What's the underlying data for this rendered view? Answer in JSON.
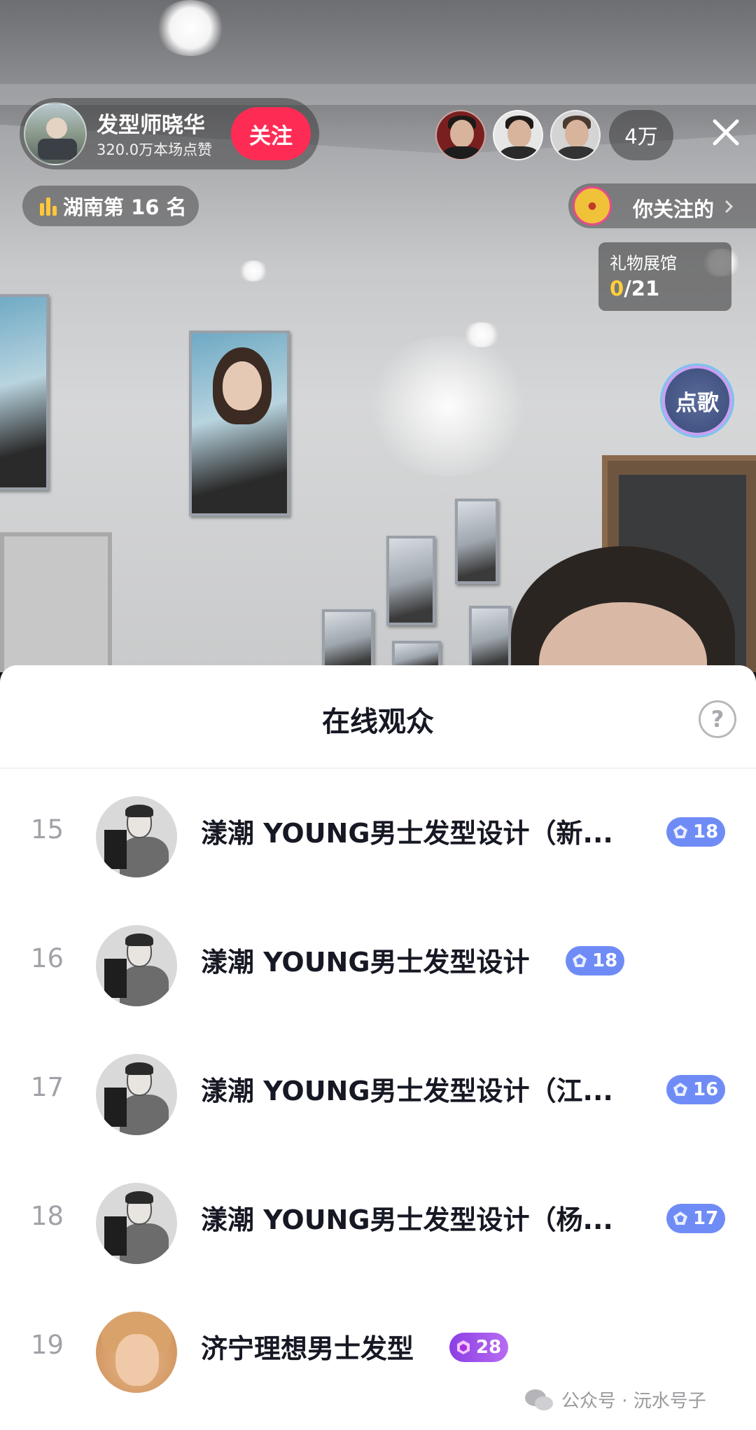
{
  "host": {
    "name": "发型师晓华",
    "likes": "320.0万本场点赞",
    "follow_label": "关注"
  },
  "audience_count": "4万",
  "rank": {
    "text": "湖南第 16 名"
  },
  "followed_text": "你关注的",
  "gift_gallery": {
    "title": "礼物展馆",
    "collected": "0",
    "total": "/21"
  },
  "song_button_label": "点歌",
  "sheet": {
    "title": "在线观众",
    "help_label": "?",
    "rows": [
      {
        "rank": "15",
        "name": "漾潮 YOUNG男士发型设计（新...",
        "level": "18"
      },
      {
        "rank": "16",
        "name": "漾潮 YOUNG男士发型设计",
        "level": "18"
      },
      {
        "rank": "17",
        "name": "漾潮 YOUNG男士发型设计（江...",
        "level": "16"
      },
      {
        "rank": "18",
        "name": "漾潮 YOUNG男士发型设计（杨...",
        "level": "17"
      },
      {
        "rank": "19",
        "name": "济宁理想男士发型",
        "level": "28"
      }
    ]
  },
  "watermark": "公众号 · 沅水号子",
  "colors": {
    "follow_button": "#fe2c55",
    "level_badge_blue": "#6f8cf6",
    "level_badge_purple": "#a855f0",
    "gift_highlight": "#ffcf3a"
  },
  "icons": [
    "rank-bars-icon",
    "close-icon",
    "chevron-right-icon",
    "help-icon",
    "level-gem-icon",
    "wechat-icon"
  ]
}
